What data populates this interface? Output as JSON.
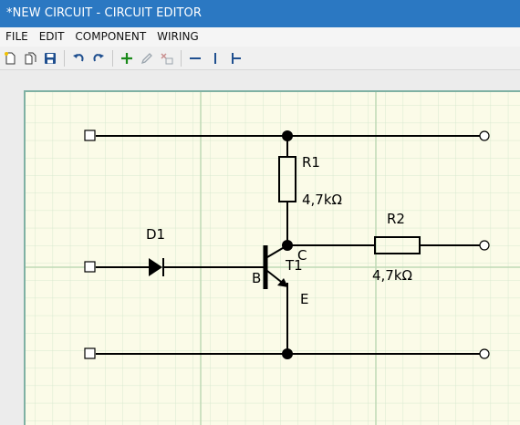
{
  "window": {
    "title": "*NEW CIRCUIT - CIRCUIT EDITOR"
  },
  "menu": {
    "items": [
      "FILE",
      "EDIT",
      "COMPONENT",
      "WIRING"
    ]
  },
  "toolbar": {
    "buttons": [
      "new-file",
      "open-file",
      "save",
      "undo",
      "redo",
      "add-component",
      "edit-component",
      "delete-component",
      "horizontal-wire",
      "vertical-wire",
      "junction-wire"
    ]
  },
  "colors": {
    "title_bar": "#2b78c2",
    "canvas": "#fbfbe8",
    "grid": "#cfe3c8",
    "wire": "#000000"
  },
  "circuit": {
    "diode": {
      "name": "D1"
    },
    "resistor1": {
      "name": "R1",
      "value": "4,7kΩ"
    },
    "resistor2": {
      "name": "R2",
      "value": "4,7kΩ"
    },
    "transistor": {
      "name": "T1",
      "base": "B",
      "collector": "C",
      "emitter": "E"
    }
  }
}
